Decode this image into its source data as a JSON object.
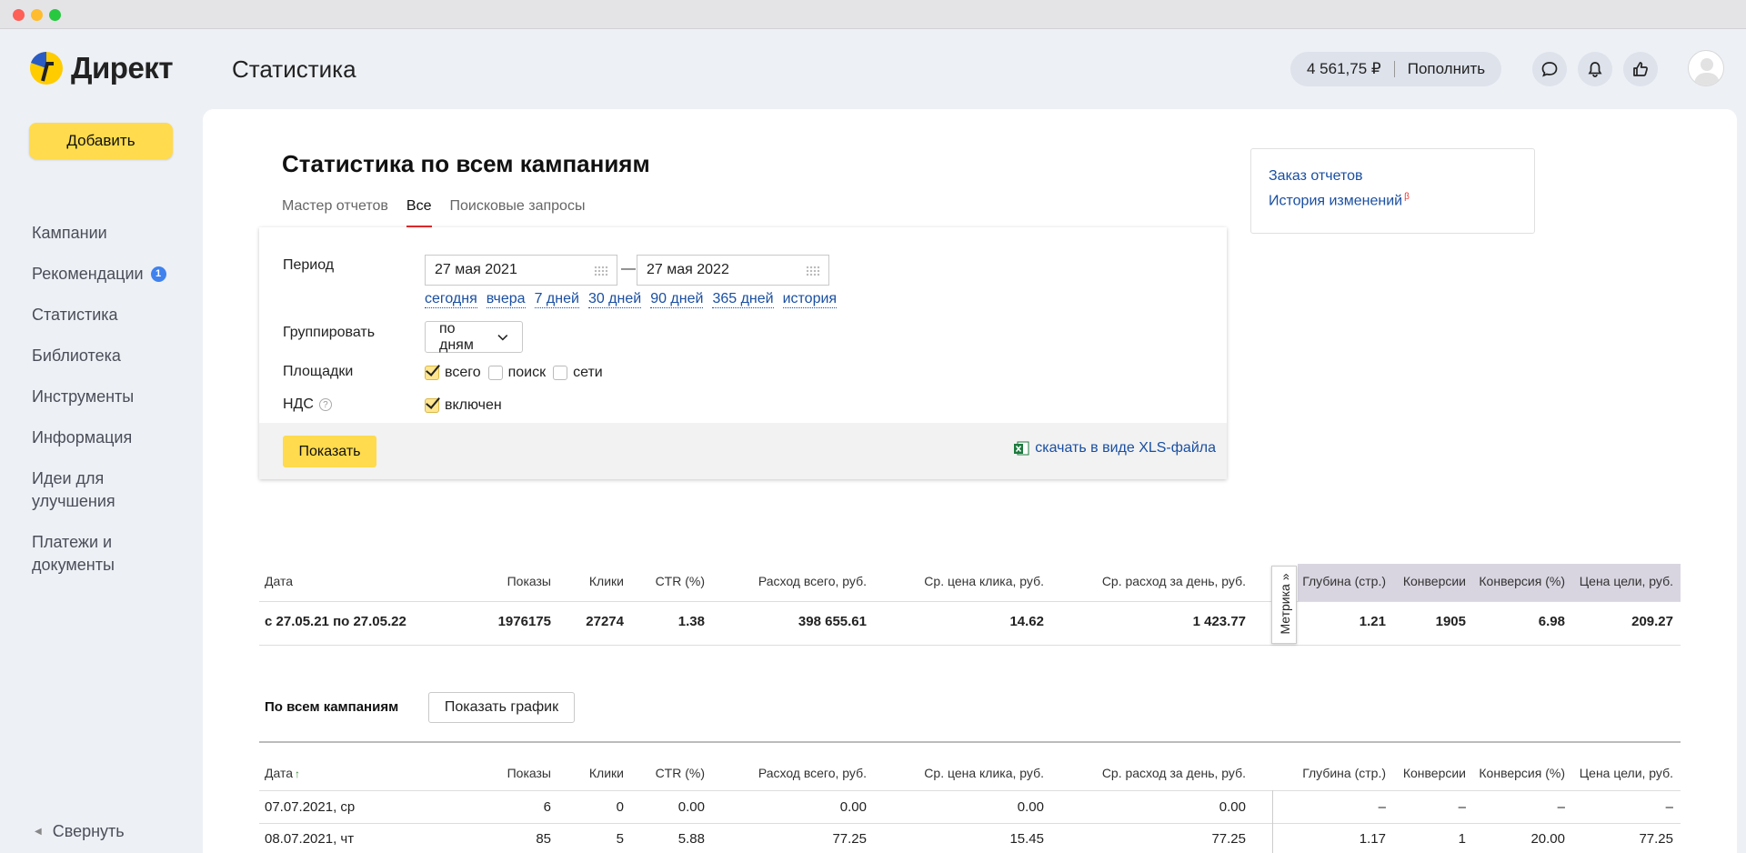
{
  "app": {
    "logo_text": "Директ",
    "header_title": "Статистика",
    "balance": "4 561,75 ₽",
    "topup": "Пополнить"
  },
  "sidebar": {
    "add_label": "Добавить",
    "items": [
      {
        "label": "Кампании"
      },
      {
        "label": "Рекомендации",
        "badge": "1"
      },
      {
        "label": "Статистика"
      },
      {
        "label": "Библиотека"
      },
      {
        "label": "Инструменты"
      },
      {
        "label": "Информация"
      },
      {
        "label": "Идеи для улучшения"
      },
      {
        "label": "Платежи и документы"
      }
    ],
    "collapse_label": "Свернуть"
  },
  "main": {
    "title": "Статистика по всем кампаниям",
    "tabs": [
      "Мастер отчетов",
      "Все",
      "Поисковые запросы"
    ],
    "active_tab": "Все",
    "side_links": [
      "Заказ отчетов",
      "История изменений"
    ],
    "beta": "β"
  },
  "filter": {
    "period_label": "Период",
    "date_from": "27 мая 2021",
    "date_to": "27 мая 2022",
    "dash": "—",
    "quick_ranges": [
      "сегодня",
      "вчера",
      "7 дней",
      "30 дней",
      "90 дней",
      "365 дней",
      "история"
    ],
    "group_label": "Группировать",
    "group_value": "по дням",
    "platforms_label": "Площадки",
    "platforms": [
      {
        "label": "всего",
        "checked": true
      },
      {
        "label": "поиск",
        "checked": false
      },
      {
        "label": "сети",
        "checked": false
      }
    ],
    "vat_label": "НДС",
    "vat_help": "?",
    "vat_option": "включен",
    "show_label": "Показать",
    "xls_label": "скачать в виде XLS-файла"
  },
  "summary_table": {
    "metrika_label": "Метрика »",
    "headers": [
      "Дата",
      "Показы",
      "Клики",
      "CTR (%)",
      "Расход всего, руб.",
      "Ср. цена клика, руб.",
      "Ср. расход за день, руб.",
      "Глубина (стр.)",
      "Конверсии",
      "Конверсия (%)",
      "Цена цели, руб."
    ],
    "row": [
      "с 27.05.21 по 27.05.22",
      "1976175",
      "27274",
      "1.38",
      "398 655.61",
      "14.62",
      "1 423.77",
      "1.21",
      "1905",
      "6.98",
      "209.27"
    ]
  },
  "campaign_section": {
    "label": "По всем кампаниям",
    "graph_button": "Показать график",
    "sort_arrow": "↑",
    "headers": [
      "Дата",
      "Показы",
      "Клики",
      "CTR (%)",
      "Расход всего, руб.",
      "Ср. цена клика, руб.",
      "Ср. расход за день, руб.",
      "Глубина (стр.)",
      "Конверсии",
      "Конверсия (%)",
      "Цена цели, руб."
    ],
    "rows": [
      [
        "07.07.2021, ср",
        "6",
        "0",
        "0.00",
        "0.00",
        "0.00",
        "0.00",
        "–",
        "–",
        "–",
        "–"
      ],
      [
        "08.07.2021, чт",
        "85",
        "5",
        "5.88",
        "77.25",
        "15.45",
        "77.25",
        "1.17",
        "1",
        "20.00",
        "77.25"
      ]
    ]
  }
}
